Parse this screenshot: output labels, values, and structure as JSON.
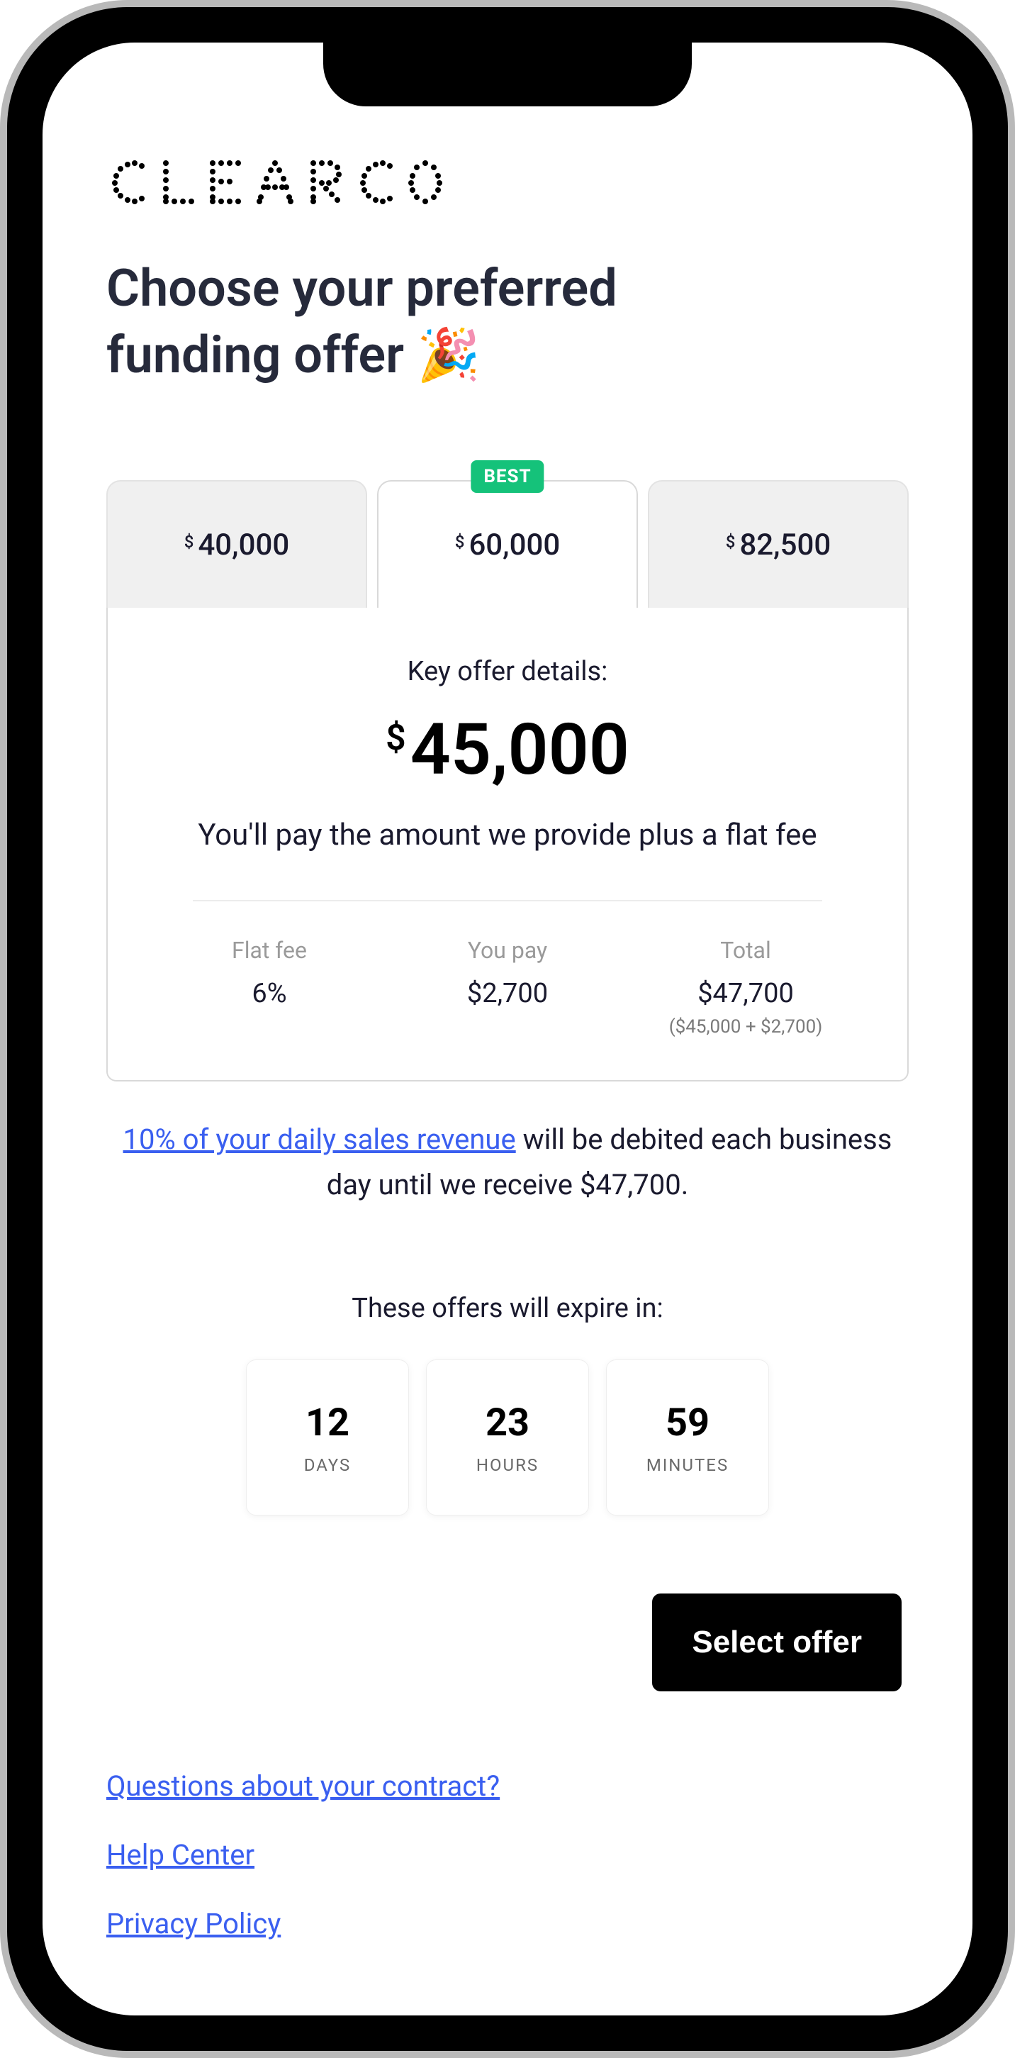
{
  "brand": "CLEARCO",
  "page_title_line1": "Choose your preferred",
  "page_title_line2": "funding offer 🎉",
  "tabs": [
    {
      "amount": "40,000",
      "best": false,
      "active": false
    },
    {
      "amount": "60,000",
      "best": true,
      "active": true
    },
    {
      "amount": "82,500",
      "best": false,
      "active": false
    }
  ],
  "best_badge": "BEST",
  "panel": {
    "heading": "Key offer details:",
    "amount": "45,000",
    "desc": "You'll pay the amount we provide plus a flat fee",
    "cols": {
      "flat_fee": {
        "label": "Flat fee",
        "value": "6%"
      },
      "you_pay": {
        "label": "You pay",
        "value": "$2,700"
      },
      "total": {
        "label": "Total",
        "value": "$47,700",
        "sub": "($45,000 + $2,700)"
      }
    }
  },
  "debit_note": {
    "link_text": "10% of your daily sales revenue",
    "rest": " will be debited each business day until we receive $47,700."
  },
  "expiry_label": "These offers will expire in:",
  "countdown": {
    "days": {
      "num": "12",
      "unit": "DAYS"
    },
    "hours": {
      "num": "23",
      "unit": "HOURS"
    },
    "minutes": {
      "num": "59",
      "unit": "MINUTES"
    }
  },
  "select_button": "Select offer",
  "footer_links": {
    "questions": "Questions about your contract?",
    "help": "Help Center",
    "privacy": "Privacy Policy"
  }
}
